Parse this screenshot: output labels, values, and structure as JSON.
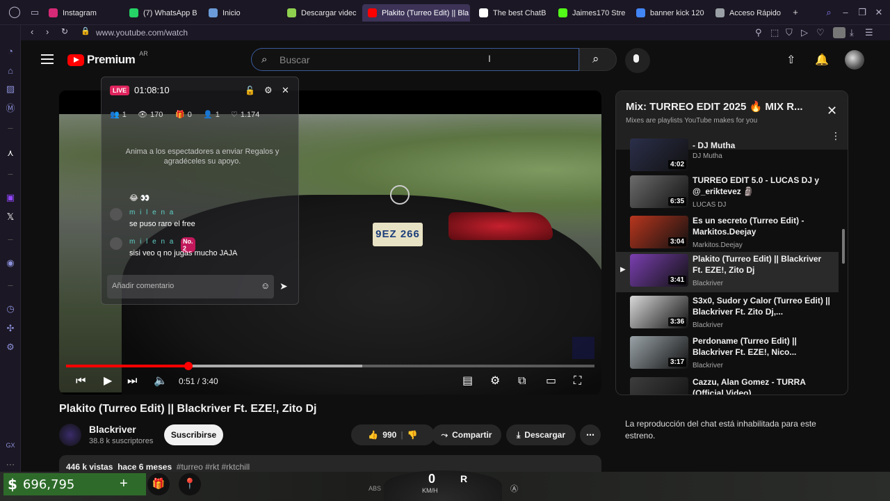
{
  "tabs": [
    {
      "label": "Instagram",
      "color": "#d62976",
      "active": false
    },
    {
      "label": "(7) WhatsApp B",
      "color": "#25d366",
      "active": false
    },
    {
      "label": "Inicio",
      "color": "#6a9bd8",
      "active": false
    },
    {
      "label": "Descargar videc",
      "color": "#8fd14f",
      "active": false
    },
    {
      "label": "Plakito (Turreo Edit) || Bla",
      "color": "#ff0000",
      "active": true
    },
    {
      "label": "The best ChatB",
      "color": "#ffffff",
      "active": false
    },
    {
      "label": "Jaimes170 Stre",
      "color": "#53fc18",
      "active": false
    },
    {
      "label": "banner kick 120",
      "color": "#4285f4",
      "active": false
    },
    {
      "label": "Acceso Rápido",
      "color": "#9aa0a6",
      "active": false
    }
  ],
  "address": {
    "url": "www.youtube.com/watch"
  },
  "header": {
    "logo": "Premium",
    "region": "AR",
    "search_placeholder": "Buscar"
  },
  "player": {
    "current_time": "0:51",
    "duration": "3:40",
    "time_display": "0:51 / 3:40",
    "progress_fraction": 0.232,
    "plate_text": "9EZ 266"
  },
  "live_overlay": {
    "badge": "LIVE",
    "timer": "01:08:10",
    "stats": [
      "1",
      "170",
      "0",
      "1",
      "1.174"
    ],
    "hint": "Anima a los espectadores a enviar Regalos y agradéceles su apoyo.",
    "messages": [
      {
        "name": "",
        "text": "😂 👀"
      },
      {
        "name": "m i l e n a",
        "text": "se puso raro el free"
      },
      {
        "name": "m i l e n a",
        "badge": "No. 2",
        "text": "sisi veo q no jugas mucho JAJA"
      }
    ],
    "comment_placeholder": "Añadir comentario"
  },
  "video": {
    "title": "Plakito (Turreo Edit) || Blackriver Ft. EZE!, Zito Dj",
    "channel": "Blackriver",
    "subscribers": "38.8 k suscriptores",
    "subscribe_label": "Suscribirse",
    "likes": "990",
    "share_label": "Compartir",
    "download_label": "Descargar",
    "views": "446 k vistas",
    "age": "hace 6 meses",
    "hashtags": "#turreo #rkt #rktchill"
  },
  "playlist": {
    "title": "Mix: TURREO EDIT 2025 🔥 MIX R...",
    "subtitle": "Mixes are playlists YouTube makes for you",
    "items": [
      {
        "title": "- DJ Mutha",
        "channel": "DJ Mutha",
        "duration": "4:02",
        "current": false,
        "thumb_color": "#2b2f4a"
      },
      {
        "title": "TURREO EDIT 5.0 - LUCAS DJ y @_eriktevez 🗿",
        "channel": "LUCAS DJ",
        "duration": "6:35",
        "current": false,
        "thumb_color": "#6c6c6c"
      },
      {
        "title": "Es un secreto (Turreo Edit) - Markitos.Deejay",
        "channel": "Markitos.Deejay",
        "duration": "3:04",
        "current": false,
        "thumb_color": "#b8361e"
      },
      {
        "title": "Plakito (Turreo Edit) || Blackriver Ft. EZE!, Zito Dj",
        "channel": "Blackriver",
        "duration": "3:41",
        "current": true,
        "thumb_color": "#7a3fb0"
      },
      {
        "title": "S3x0, Sudor y Calor (Turreo Edit) || Blackriver Ft. Zito Dj,...",
        "channel": "Blackriver",
        "duration": "3:36",
        "current": false,
        "thumb_color": "#d9d9d9"
      },
      {
        "title": "Perdoname (Turreo Edit) || Blackriver Ft. EZE!, Nico...",
        "channel": "Blackriver",
        "duration": "3:17",
        "current": false,
        "thumb_color": "#9aa3a8"
      },
      {
        "title": "Cazzu, Alan Gomez - TURRA (Official Video)",
        "channel": "",
        "duration": "",
        "current": false,
        "thumb_color": "#3d3d3d"
      }
    ]
  },
  "chat_disabled": "La reproducción del chat está inhabilitada para este estreno.",
  "hud": {
    "money": "696,795",
    "speed": "0",
    "speed_unit": "KM/H",
    "gear": "R",
    "abs_label": "ABS"
  },
  "sidebar": {
    "footer_label": "GX"
  }
}
